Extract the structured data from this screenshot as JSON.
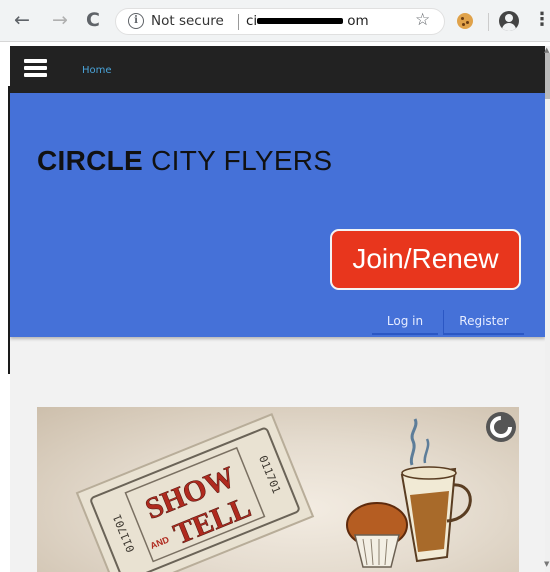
{
  "browser": {
    "back_glyph": "←",
    "forward_glyph": "→",
    "reload_glyph": "C",
    "info_glyph": "i",
    "security_label": "Not secure",
    "url_prefix": "ci",
    "url_suffix": "om",
    "star_glyph": "☆",
    "menu_glyph": "⋮"
  },
  "site": {
    "nav": {
      "home_label": "Home"
    },
    "title_bold": "CIRCLE",
    "title_regular": " CITY FLYERS",
    "join_label": "Join/Renew",
    "login_label": "Log in",
    "register_label": "Register"
  },
  "promo": {
    "ticket_text_top": "SHOW",
    "ticket_text_and": "AND",
    "ticket_text_bottom": "TELL",
    "ticket_serial": "011701"
  },
  "colors": {
    "hero": "#4571d8",
    "join_button": "#e8361d",
    "topbar": "#222222"
  }
}
